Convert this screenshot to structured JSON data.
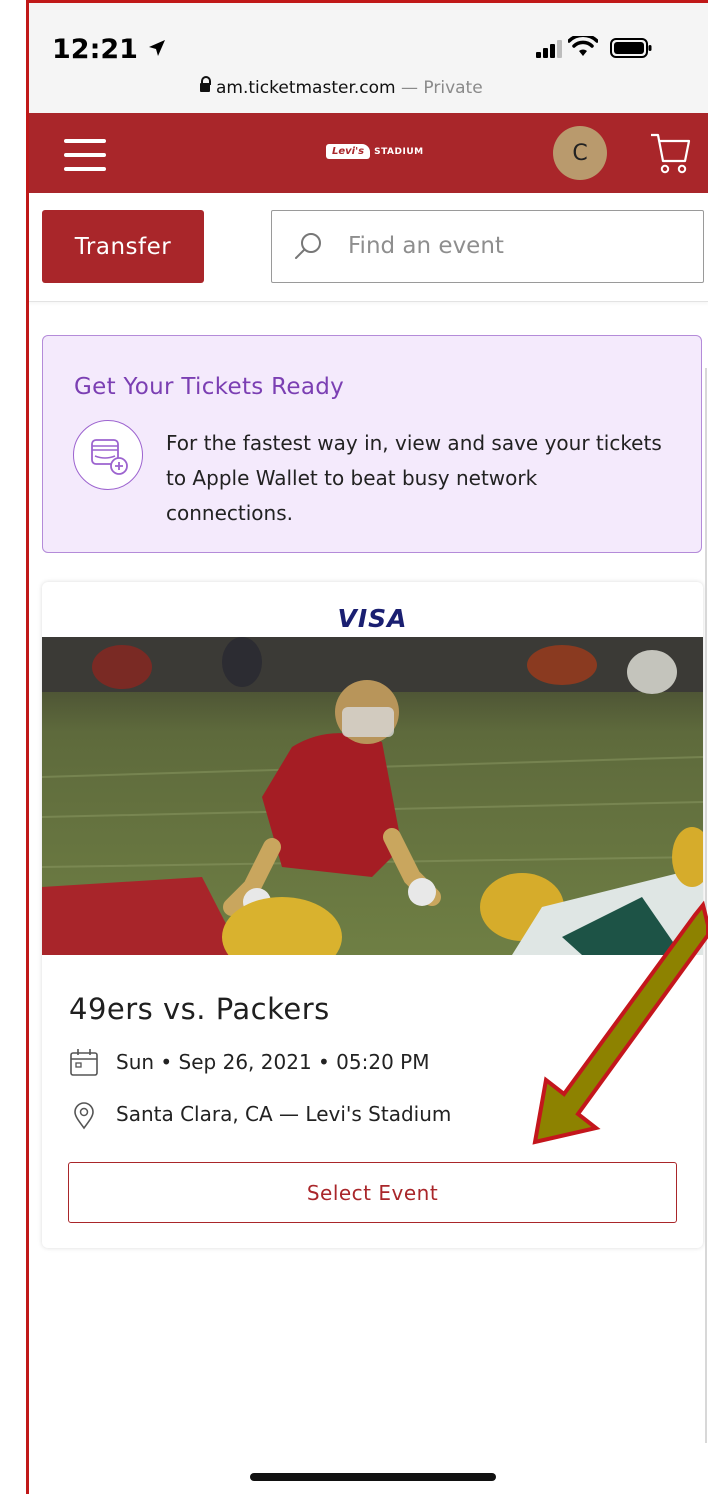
{
  "status_bar": {
    "time": "12:21",
    "url": "am.ticketmaster.com",
    "url_suffix": "— Private"
  },
  "navbar": {
    "logo_brand": "Levi's",
    "logo_venue": "STADIUM",
    "avatar_initial": "C",
    "color": "#a9262a"
  },
  "toolbar": {
    "transfer_label": "Transfer",
    "search_placeholder": "Find an event"
  },
  "wallet_banner": {
    "title": "Get Your Tickets Ready",
    "body": "For the fastest way in, view and save your tickets to Apple Wallet to beat busy network connections.",
    "accent": "#7b3fb3"
  },
  "event": {
    "sponsor": "VISA",
    "title": "49ers vs. Packers",
    "date": "Sun • Sep 26, 2021 • 05:20 PM",
    "venue": "Santa Clara, CA — Levi's Stadium",
    "select_label": "Select Event"
  },
  "icons": [
    "menu-icon",
    "cart-icon",
    "search-icon",
    "wallet-add-icon",
    "calendar-icon",
    "location-pin-icon"
  ]
}
